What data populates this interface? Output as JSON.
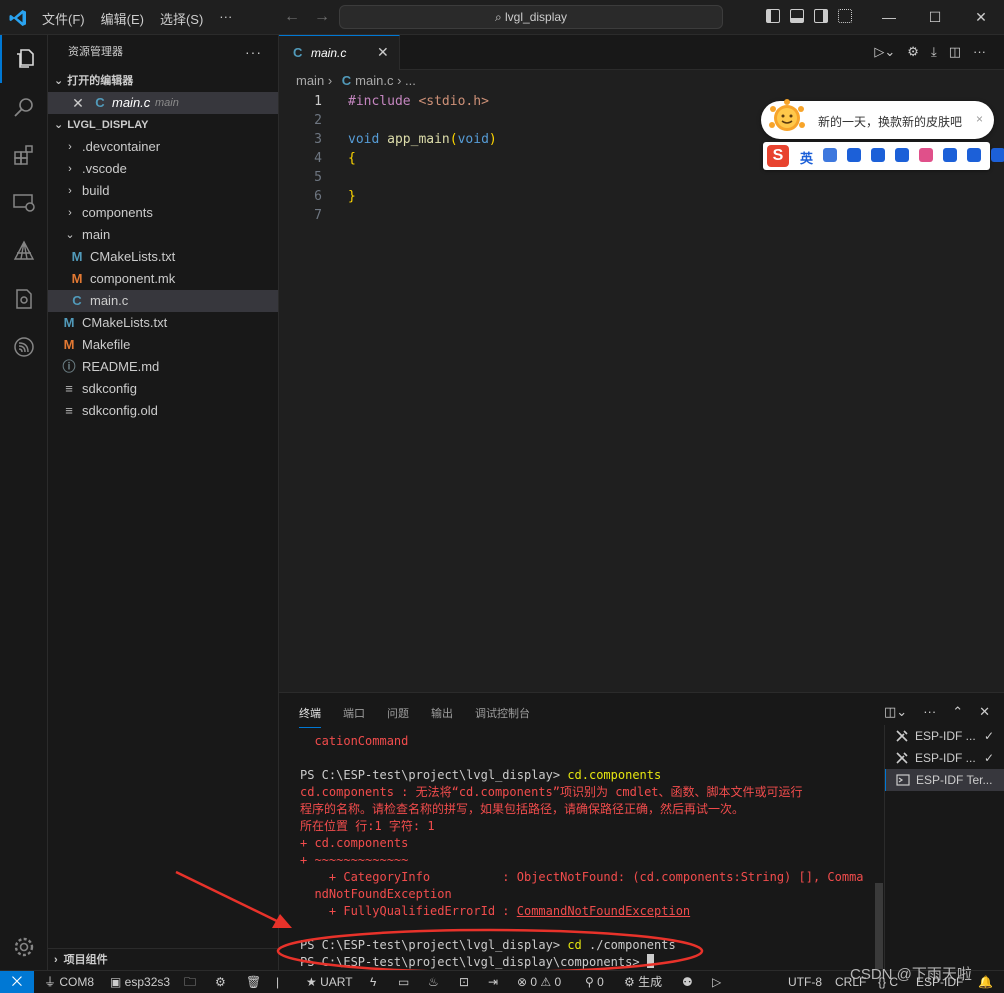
{
  "titlebar": {
    "menu": [
      "文件(F)",
      "编辑(E)",
      "选择(S)",
      "···"
    ],
    "search": "lvgl_display"
  },
  "sidebar": {
    "header": "资源管理器",
    "more": "···",
    "open_editors_title": "打开的编辑器",
    "open_editor": {
      "name": "main.c",
      "folder": "main"
    },
    "project_title": "LVGL_DISPLAY",
    "tree": [
      {
        "label": ".devcontainer",
        "type": "folder",
        "depth": 1,
        "expanded": false
      },
      {
        "label": ".vscode",
        "type": "folder",
        "depth": 1,
        "expanded": false
      },
      {
        "label": "build",
        "type": "folder",
        "depth": 1,
        "expanded": false
      },
      {
        "label": "components",
        "type": "folder",
        "depth": 1,
        "expanded": false
      },
      {
        "label": "main",
        "type": "folder",
        "depth": 1,
        "expanded": true
      },
      {
        "label": "CMakeLists.txt",
        "type": "cmake",
        "depth": 2
      },
      {
        "label": "component.mk",
        "type": "make",
        "depth": 2
      },
      {
        "label": "main.c",
        "type": "c",
        "depth": 2,
        "selected": true
      },
      {
        "label": "CMakeLists.txt",
        "type": "cmake",
        "depth": 1
      },
      {
        "label": "Makefile",
        "type": "make",
        "depth": 1
      },
      {
        "label": "README.md",
        "type": "info",
        "depth": 1
      },
      {
        "label": "sdkconfig",
        "type": "file",
        "depth": 1
      },
      {
        "label": "sdkconfig.old",
        "type": "file",
        "depth": 1
      }
    ],
    "outline_title": "项目组件"
  },
  "editor": {
    "tab_label": "main.c",
    "breadcrumb": [
      "main",
      "main.c",
      "..."
    ],
    "lines": [
      {
        "n": "1",
        "tokens": [
          [
            "pp",
            "#include "
          ],
          [
            "str",
            "<stdio.h>"
          ]
        ]
      },
      {
        "n": "2",
        "tokens": []
      },
      {
        "n": "3",
        "tokens": [
          [
            "kw",
            "void "
          ],
          [
            "fn",
            "app_main"
          ],
          [
            "br",
            "("
          ],
          [
            "kw",
            "void"
          ],
          [
            "br",
            ")"
          ]
        ]
      },
      {
        "n": "4",
        "tokens": [
          [
            "br",
            "{"
          ]
        ]
      },
      {
        "n": "5",
        "tokens": []
      },
      {
        "n": "6",
        "tokens": [
          [
            "br",
            "}"
          ]
        ]
      },
      {
        "n": "7",
        "tokens": []
      }
    ]
  },
  "ime": {
    "message": "新的一天，换款新的皮肤吧",
    "close": "×",
    "logo": "S",
    "lang": "英",
    "tool_colors": [
      "#1c60d8",
      "#1c60d8",
      "#1c60d8",
      "#1c60d8",
      "#e0508a",
      "#1c60d8",
      "#1c60d8",
      "#1c60d8"
    ]
  },
  "panel": {
    "tabs": [
      "终端",
      "端口",
      "问题",
      "输出",
      "调试控制台"
    ],
    "terminal_lines": [
      [
        [
          "err",
          "  cationCommand"
        ]
      ],
      [],
      [
        [
          "norm",
          "PS C:\\ESP-test\\project\\lvgl_display> "
        ],
        [
          "cmd",
          "cd.components"
        ]
      ],
      [
        [
          "err",
          "cd.components : 无法将“cd.components”项识别为 cmdlet、函数、脚本文件或可运行"
        ]
      ],
      [
        [
          "err",
          "程序的名称。请检查名称的拼写，如果包括路径，请确保路径正确，然后再试一次。"
        ]
      ],
      [
        [
          "err",
          "所在位置 行:1 字符: 1"
        ]
      ],
      [
        [
          "err",
          "+ cd.components"
        ]
      ],
      [
        [
          "err",
          "+ ~~~~~~~~~~~~~"
        ]
      ],
      [
        [
          "err",
          "    + CategoryInfo          : ObjectNotFound: (cd.components:String) [], Comma"
        ]
      ],
      [
        [
          "err",
          "  ndNotFoundException"
        ]
      ],
      [
        [
          "err",
          "    + FullyQualifiedErrorId : "
        ],
        [
          "ul",
          "CommandNotFoundException"
        ]
      ],
      [],
      [
        [
          "norm",
          "PS C:\\ESP-test\\project\\lvgl_display> "
        ],
        [
          "cmd",
          "cd"
        ],
        [
          "norm",
          " ./components"
        ]
      ],
      [
        [
          "norm",
          "PS C:\\ESP-test\\project\\lvgl_display\\components> "
        ]
      ]
    ],
    "terminals": [
      {
        "label": "ESP-IDF ...",
        "check": "✓"
      },
      {
        "label": "ESP-IDF ...",
        "check": "✓"
      },
      {
        "label": "ESP-IDF Ter...",
        "check": ""
      }
    ]
  },
  "statusbar": {
    "remote": "⨉",
    "port": "COM8",
    "target": "esp32s3",
    "uart": "UART",
    "problems": "⊗ 0 ⚠ 0",
    "ports": "0",
    "build": "生成",
    "encoding": "UTF-8",
    "eol": "CRLF",
    "lang": "{} C",
    "idf": "ESP-IDF"
  },
  "watermark": "CSDN @下雨天啦"
}
